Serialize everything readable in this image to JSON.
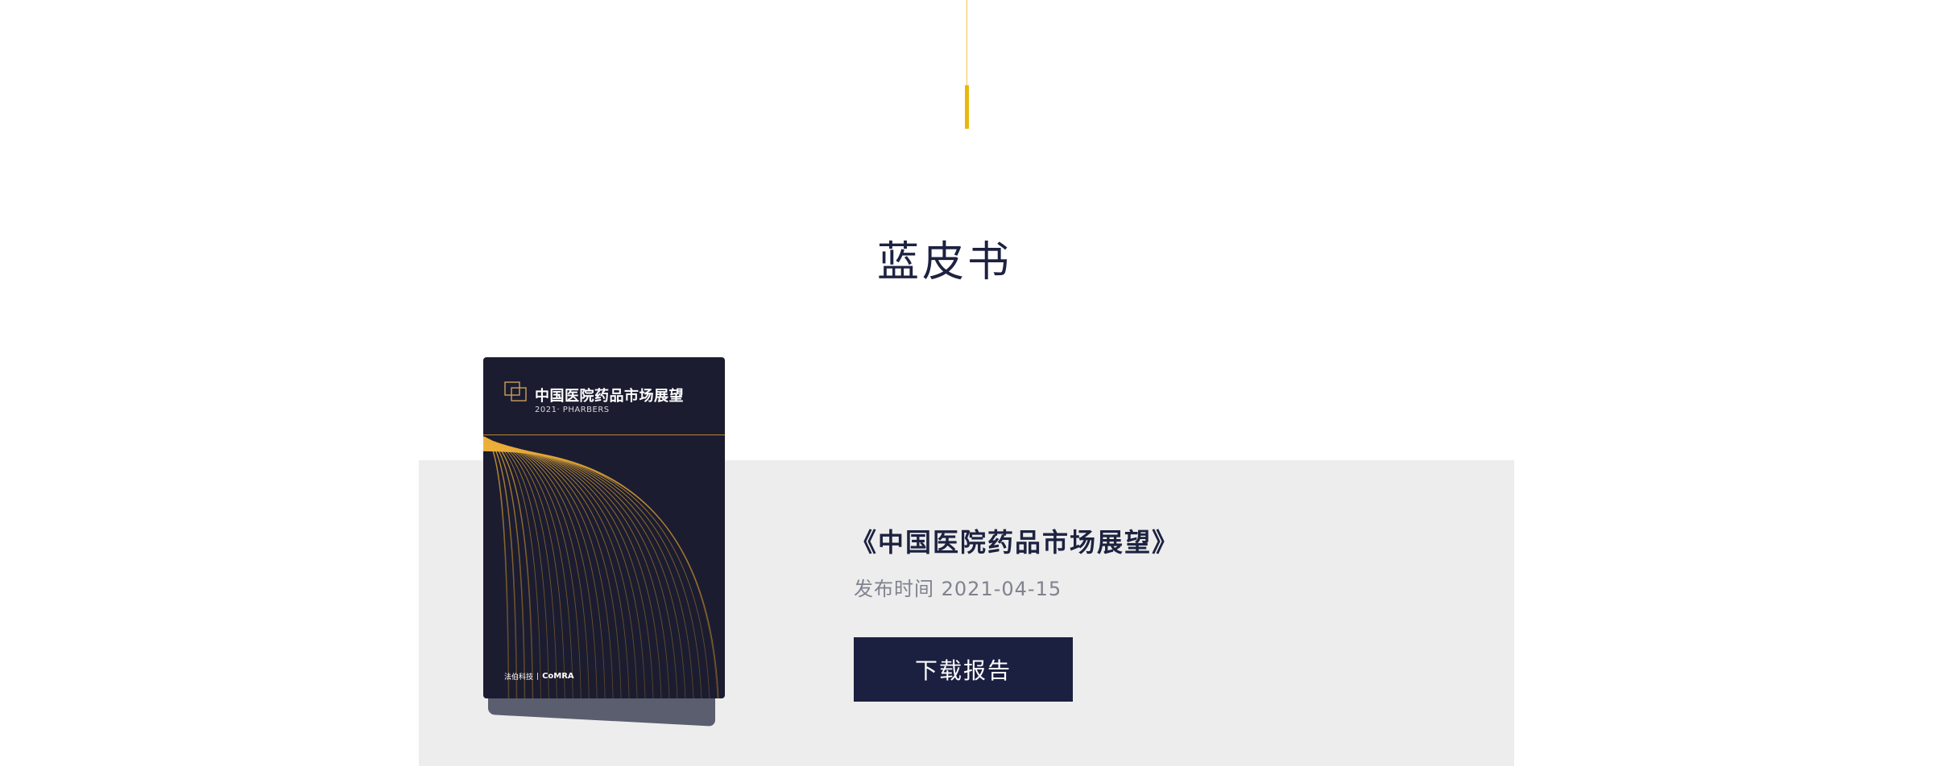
{
  "section": {
    "title": "蓝皮书"
  },
  "report": {
    "cover": {
      "title": "中国医院药品市场展望",
      "subtitle": "2021· PHARBERS",
      "footer_left": "法伯科技",
      "footer_sep": "|",
      "footer_right": "CoMRA"
    },
    "name": "《中国医院药品市场展望》",
    "date_label": "发布时间",
    "date_value": "2021-04-15",
    "download_label": "下载报告"
  },
  "colors": {
    "accent": "#e8b80f",
    "navy": "#1b1f40",
    "panel": "#ededed",
    "muted_text": "#80828e"
  }
}
